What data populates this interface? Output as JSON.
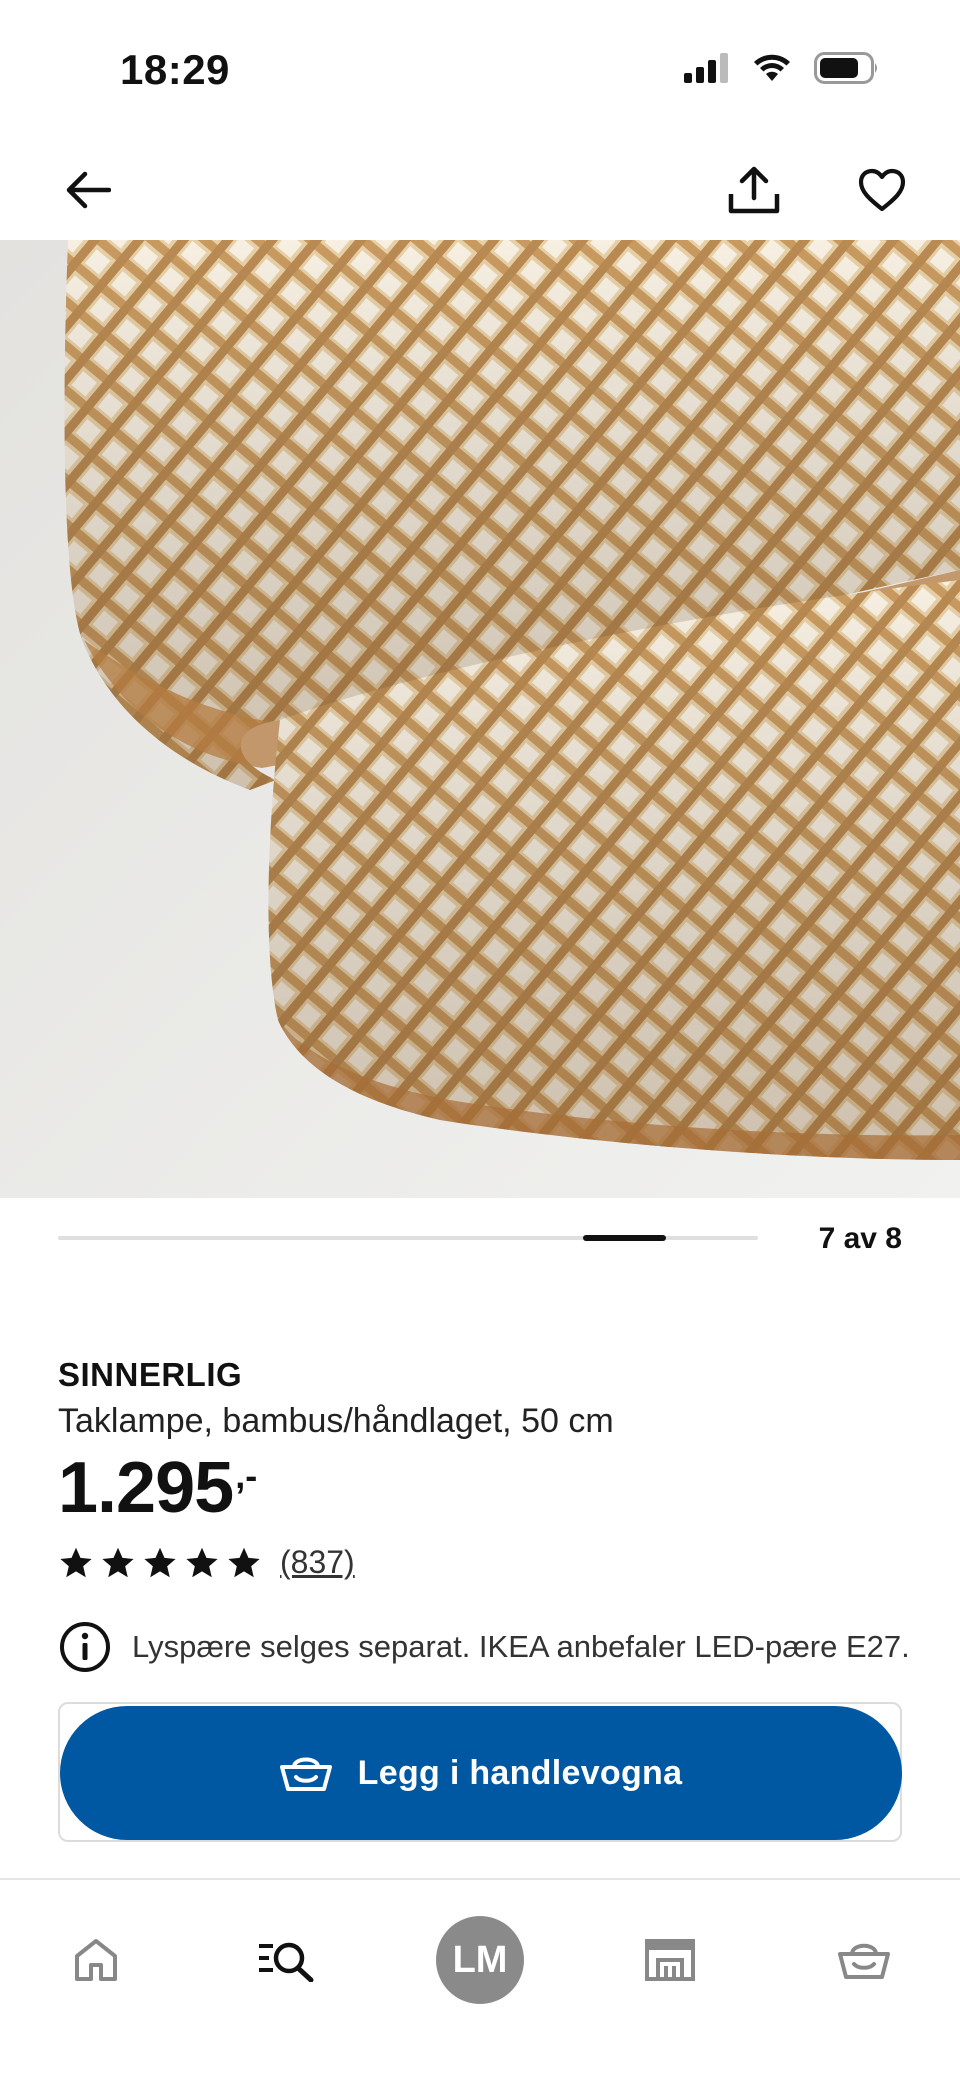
{
  "status_bar": {
    "time": "18:29"
  },
  "top_nav": {
    "back_icon": "arrow-left-icon",
    "share_icon": "share-icon",
    "favorite_icon": "heart-icon"
  },
  "product_image": {
    "description_icon": "bamboo-lamp-image"
  },
  "pager": {
    "current": 7,
    "total": 8,
    "label": "7 av 8"
  },
  "product": {
    "name": "SINNERLIG",
    "description": "Taklampe, bambus/håndlaget, 50 cm",
    "price": "1.295",
    "price_suffix": ",-",
    "rating": 5,
    "rating_max": 5,
    "review_count": "(837)",
    "info_note": "Lyspære selges separat. IKEA anbefaler LED-pære E27."
  },
  "cart_button": {
    "label": "Legg i handlevogna",
    "icon": "basket-icon",
    "color": "#0058a3"
  },
  "tab_bar": {
    "items": [
      {
        "name": "home",
        "icon": "home-icon"
      },
      {
        "name": "search",
        "icon": "search-menu-icon"
      },
      {
        "name": "profile",
        "avatar_initials": "LM"
      },
      {
        "name": "store",
        "icon": "store-icon"
      },
      {
        "name": "basket",
        "icon": "basket-icon"
      }
    ]
  }
}
